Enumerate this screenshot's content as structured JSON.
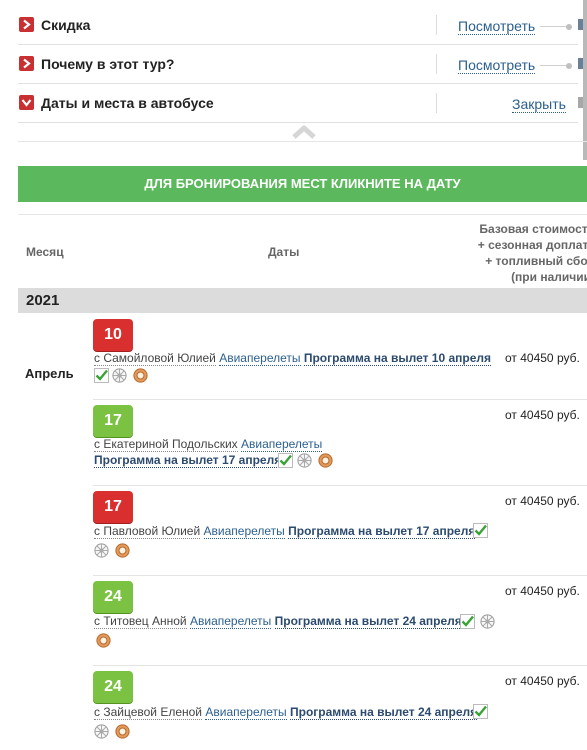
{
  "accordion": [
    {
      "title": "Скидка",
      "link": "Посмотреть",
      "icon": "chevron-right-icon"
    },
    {
      "title": "Почему в этот тур?",
      "link": "Посмотреть",
      "icon": "chevron-right-icon"
    },
    {
      "title": "Даты и места в автобусе",
      "link": "Закрыть",
      "icon": "chevron-down-icon"
    }
  ],
  "booking_banner": "ДЛЯ БРОНИРОВАНИЯ МЕСТ КЛИКНИТЕ НА ДАТУ",
  "table_header": {
    "month": "Месяц",
    "dates": "Даты",
    "price_lines": [
      "Базовая стоимость",
      "+ сезонная доплата",
      "+ топливный сбор",
      "(при наличии)"
    ]
  },
  "year": "2021",
  "month": "Апрель",
  "tours": [
    {
      "day": "10",
      "status": "red",
      "guide": "с Самойловой Юлией",
      "air": "Авиаперелеты",
      "program": "Программа на вылет 10 апреля",
      "price": "от 40450 руб."
    },
    {
      "day": "17",
      "status": "green",
      "guide": "с Екатериной Подольских",
      "air": "Авиаперелеты",
      "program": "Программа на вылет 17 апреля",
      "price": "от 40450 руб."
    },
    {
      "day": "17",
      "status": "red",
      "guide": "с Павловой Юлией",
      "air": "Авиаперелеты",
      "program": "Программа на вылет 17 апреля",
      "price": "от 40450 руб."
    },
    {
      "day": "24",
      "status": "green",
      "guide": "с Титовец Анной",
      "air": "Авиаперелеты",
      "program": "Программа на вылет 24 апреля",
      "price": "от 40450 руб."
    },
    {
      "day": "24",
      "status": "green",
      "guide": "с Зайцевой Еленой",
      "air": "Авиаперелеты",
      "program": "Программа на вылет 24 апреля",
      "price": "от 40450 руб."
    }
  ],
  "colors": {
    "accent_green": "#5cb85c",
    "badge_red": "#d9302f",
    "badge_green": "#7cc242",
    "link_blue": "#2b5f8f"
  }
}
